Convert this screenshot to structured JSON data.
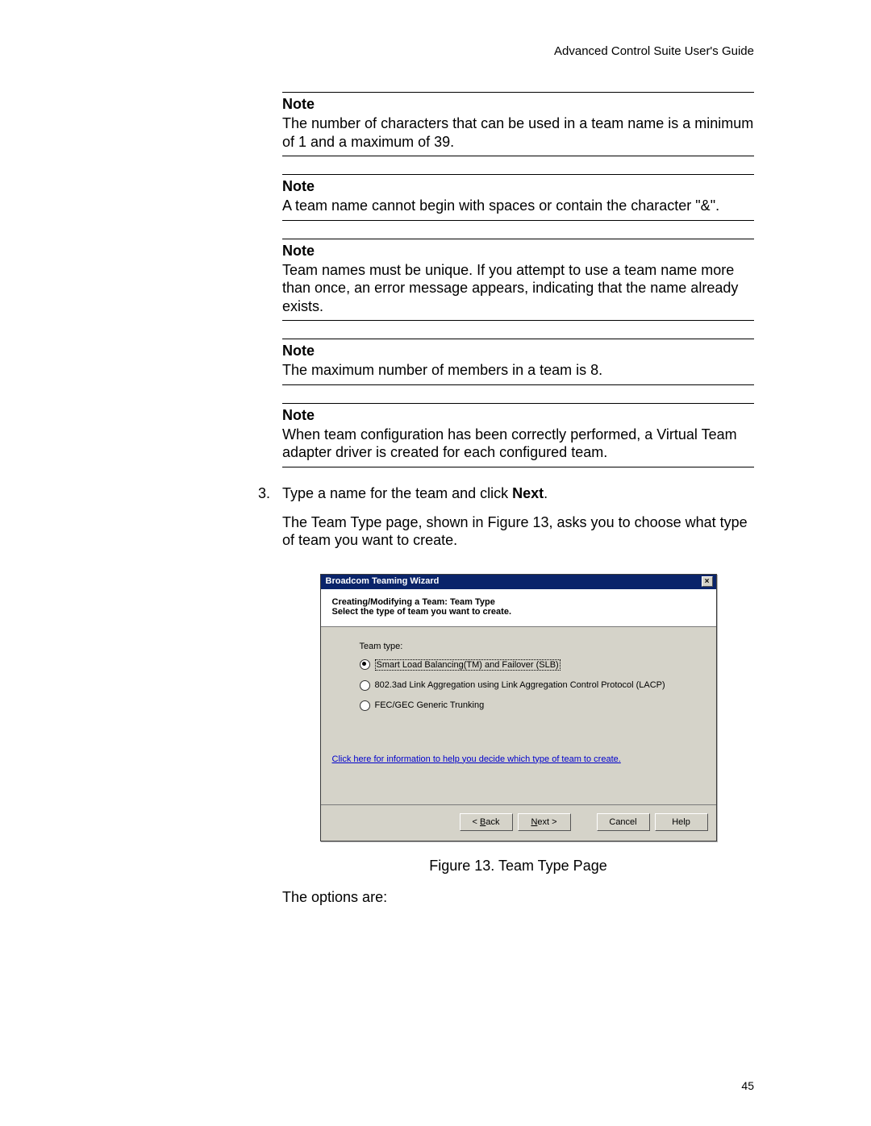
{
  "header": {
    "doc_title": "Advanced Control Suite User's Guide"
  },
  "notes": [
    {
      "title": "Note",
      "body": "The number of characters that can be used in a team name is a minimum of 1 and a maximum of 39."
    },
    {
      "title": "Note",
      "body": "A team name cannot begin with spaces or contain the character \"&\"."
    },
    {
      "title": "Note",
      "body": "Team names must be unique. If you attempt to use a team name more than once, an error message appears, indicating that the name already exists."
    },
    {
      "title": "Note",
      "body": "The maximum number of members in a team is 8."
    },
    {
      "title": "Note",
      "body": "When team configuration has been correctly performed, a Virtual Team adapter driver is created for each configured team."
    }
  ],
  "step": {
    "number": "3.",
    "text_before_bold": "Type a name for the team and click ",
    "bold": "Next",
    "text_after_bold": "."
  },
  "follow_para": "The Team Type page, shown in Figure 13, asks you to choose what type of team you want to create.",
  "wizard": {
    "title": "Broadcom Teaming Wizard",
    "heading1": "Creating/Modifying a Team:  Team Type",
    "heading2": "Select the type of team you want to create.",
    "team_type_label": "Team type:",
    "options": [
      {
        "label": "Smart Load Balancing(TM) and Failover (SLB)",
        "selected": true
      },
      {
        "label": "802.3ad Link Aggregation using Link Aggregation Control Protocol (LACP)",
        "selected": false
      },
      {
        "label": "FEC/GEC Generic Trunking",
        "selected": false
      }
    ],
    "help_link": "Click here for information to help you decide which type of team to create.",
    "buttons": {
      "back_u": "B",
      "back_rest": "ack",
      "back_prefix": "< ",
      "next_u": "N",
      "next_rest": "ext >",
      "cancel": "Cancel",
      "help": "Help"
    }
  },
  "figure_caption": "Figure 13. Team Type Page",
  "options_intro": "The options are:",
  "page_number": "45"
}
